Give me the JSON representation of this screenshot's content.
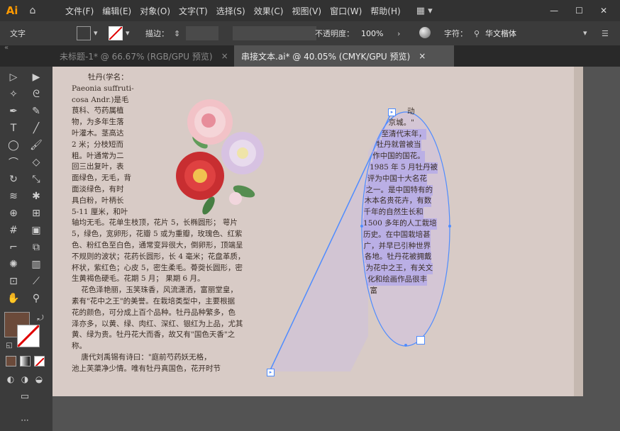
{
  "app": {
    "logo": "Ai",
    "workspace_icon": "grid-icon"
  },
  "menu": [
    "文件(F)",
    "编辑(E)",
    "对象(O)",
    "文字(T)",
    "选择(S)",
    "效果(C)",
    "视图(V)",
    "窗口(W)",
    "帮助(H)"
  ],
  "control": {
    "tool_label": "文字",
    "stroke_label": "描边：",
    "opacity_label": "不透明度：",
    "opacity_value": "100%",
    "char_label": "字符：",
    "font_value": "华文楷体",
    "fill_color": "#6b4a3a"
  },
  "tabs": [
    {
      "label": "未标题-1* @ 66.67% (RGB/GPU 预览)",
      "active": false
    },
    {
      "label": "串接文本.ai* @ 40.05% (CMYK/GPU 预览)",
      "active": true
    }
  ],
  "colors": {
    "fill": "#6b4a3a",
    "stroke": "#ffffff",
    "accent": "#4f8cff"
  },
  "text_left": [
    "牡丹(学名：",
    "Paeonia suffruti-",
    "cosa Andr.)是毛",
    "茛科、芍药属植",
    "物，为多年生落",
    "叶灌木。茎高达",
    "2 米；分枝短而",
    "粗。叶通常为二",
    "回三出复叶，表",
    "面绿色，无毛，背",
    "面淡绿色，有时",
    "具白粉，叶柄长",
    "5-11 厘米，和叶",
    "轴均无毛。花单生枝顶，花片 5，长椭圆形； 萼片",
    "5，绿色，宽卵形，花瓣 5 或为重瓣，玫瑰色、红紫",
    "色、粉红色至白色，通常变异很大，倒卵形，顶端呈",
    "不规则的波状；花药长圆形，长 4 毫米；花盘革质，",
    "杯状，紫红色；心皮 5，密生柔毛。蓇葖长圆形，密",
    "生黄褐色硬毛。花期 5 月； 果期 6 月。",
    "    花色泽艳丽，玉笑珠香，风流潇洒，富丽堂皇，",
    "素有\"花中之王\"的美誉。在栽培类型中，主要根据",
    "花的颜色，可分成上百个品种。牡丹品种繁多，色",
    "泽亦多，以黄、绿、肉红、深红、银红为上品，尤其",
    "黄、绿为贵。牡丹花大而香，故又有\"国色天香\"之",
    "称。",
    "    唐代刘禹锡有诗曰：\"庭前芍药妖无格，",
    "池上芙蕖净少情。唯有牡丹真国色，花开时节"
  ],
  "text_oval": [
    "动",
    "京城。\"",
    "至清代末年，",
    "牡丹就曾被当",
    "作中国的国花。",
    "1985 年 5 月牡丹被",
    "评为中国十大名花",
    "之一。是中国特有的",
    "木本名贵花卉，有数",
    "千年的自然生长和",
    "1500 多年的人工栽培",
    "历史。在中国栽培甚",
    "广，并早已引种世界",
    "各地。牡丹花被拥戴",
    "为花中之王，有关文",
    "化和绘画作品很丰",
    "富"
  ]
}
